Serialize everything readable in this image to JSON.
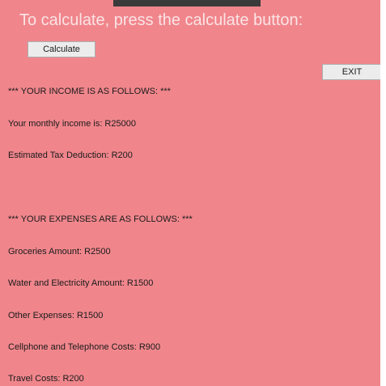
{
  "window": {
    "heading": "To calculate, press the calculate button:"
  },
  "buttons": {
    "calculate_label": "Calculate",
    "exit_label": "EXIT"
  },
  "output": {
    "income_header": "*** YOUR INCOME IS AS FOLLOWS: ***",
    "monthly_income": "Your monthly income is: R25000",
    "tax_deduction": "Estimated Tax Deduction: R200",
    "expenses_header": "*** YOUR EXPENSES ARE AS FOLLOWS: ***",
    "groceries": "Groceries Amount: R2500",
    "water_electricity": "Water and Electricity Amount: R1500",
    "other_expenses": "Other Expenses: R1500",
    "cellphone_telephone": "Cellphone and Telephone Costs: R900",
    "travel_costs": "Travel Costs: R200"
  },
  "colors": {
    "background": "#f0868c",
    "heading_text": "#fbe3e5",
    "button_face": "#ececec"
  }
}
